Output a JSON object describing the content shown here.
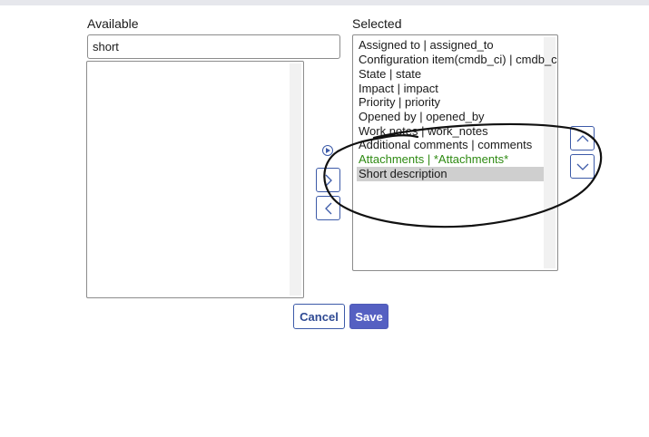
{
  "available": {
    "label": "Available",
    "filter_value": "short",
    "items": []
  },
  "selected": {
    "label": "Selected",
    "items": [
      {
        "text": "Assigned to | assigned_to"
      },
      {
        "text": "Configuration item(cmdb_ci) | cmdb_ci"
      },
      {
        "text": "State | state"
      },
      {
        "text": "Impact | impact"
      },
      {
        "text": "Priority | priority"
      },
      {
        "text": "Opened by | opened_by"
      },
      {
        "text": "Work notes | work_notes"
      },
      {
        "text": "Additional comments | comments"
      },
      {
        "text": "Attachments | *Attachments*",
        "highlight": true
      },
      {
        "text": "Short description",
        "selected": true
      }
    ]
  },
  "controls": {
    "add_icon": "chevron-right-icon",
    "remove_icon": "chevron-left-icon",
    "play_icon": "play-circle-icon",
    "move_up_icon": "chevron-up-icon",
    "move_down_icon": "chevron-down-icon"
  },
  "buttons": {
    "cancel_label": "Cancel",
    "save_label": "Save"
  },
  "colors": {
    "accent": "#3c5aa8",
    "save_bg": "#5560c2",
    "highlight_text": "#2e8a12",
    "selected_row_bg": "#cfcfcf"
  }
}
